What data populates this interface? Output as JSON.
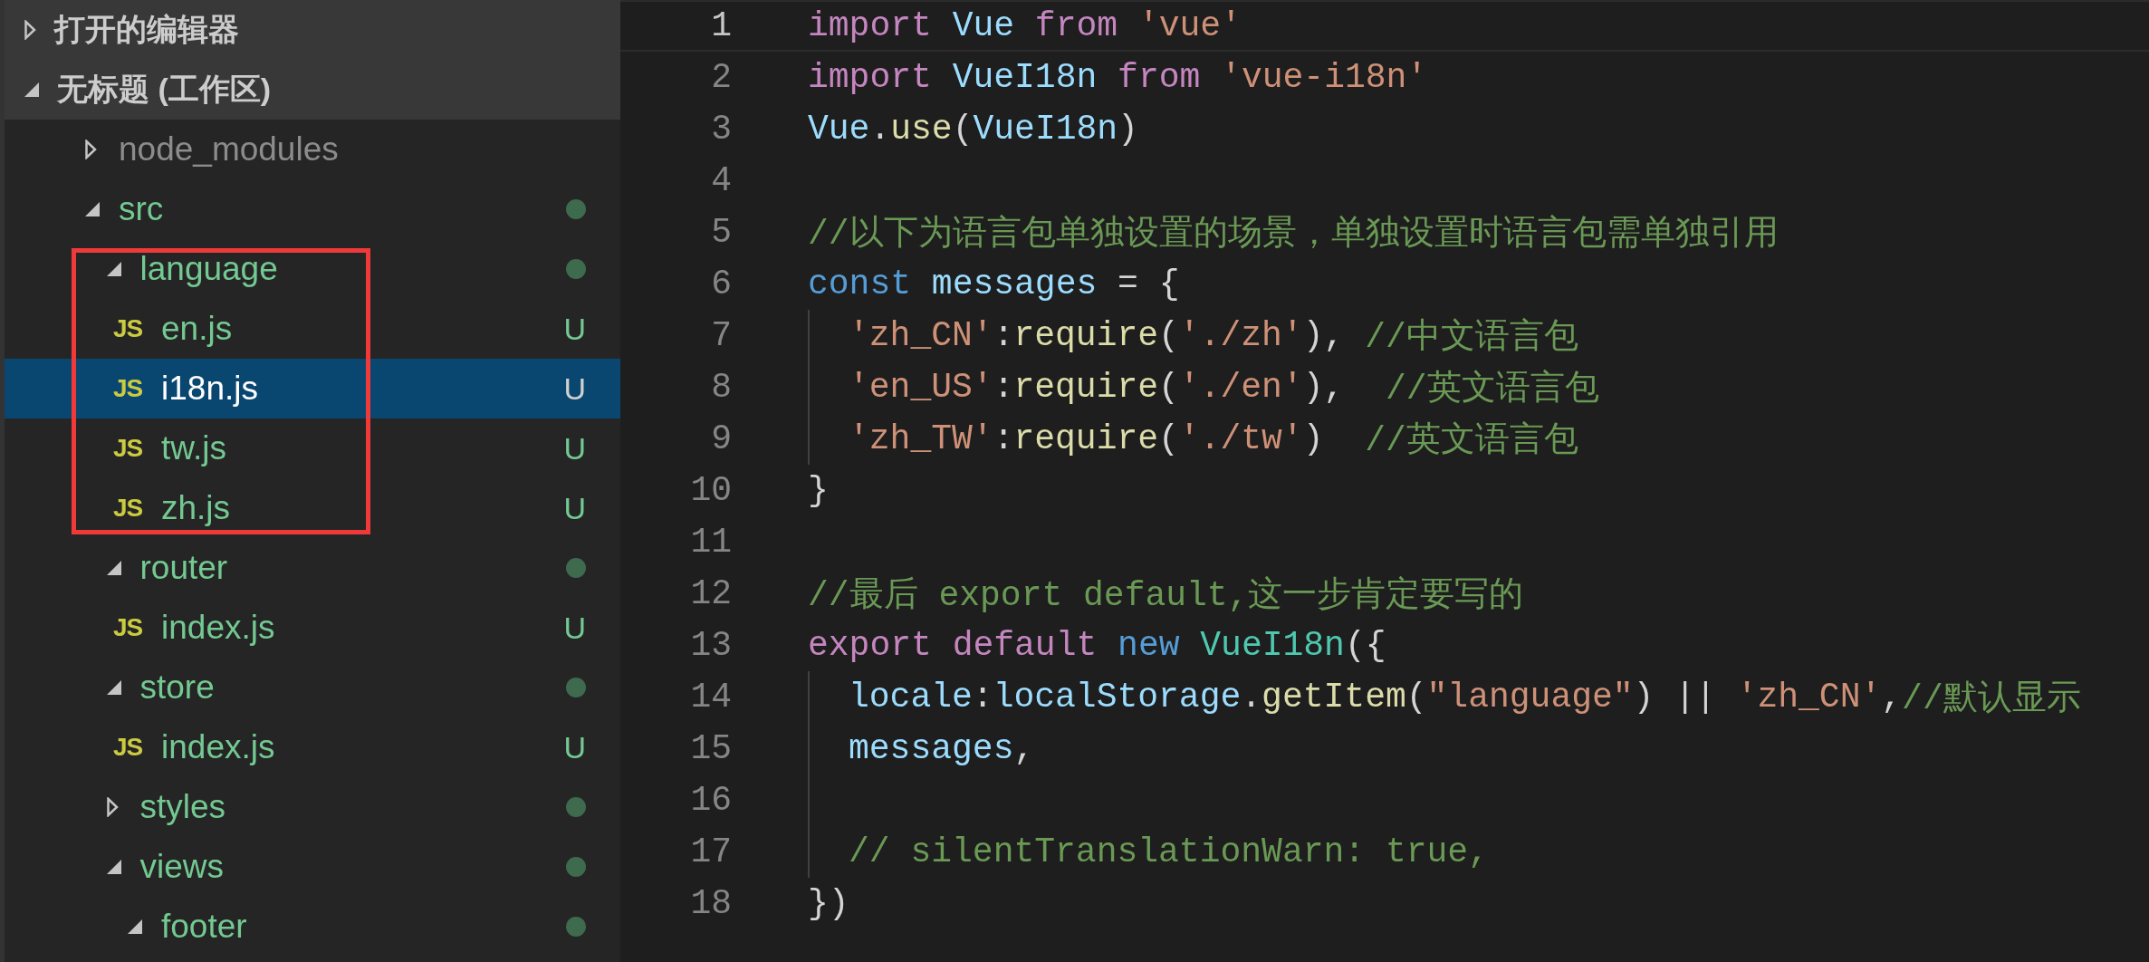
{
  "explorer": {
    "sections": [
      {
        "title": "打开的编辑器",
        "expanded": false
      },
      {
        "title": "无标题 (工作区)",
        "expanded": true,
        "tree": [
          {
            "kind": "folder",
            "name": "node_modules",
            "expanded": false,
            "ignored": true,
            "modified": false,
            "selected": false,
            "framed": false
          },
          {
            "kind": "folder",
            "name": "src",
            "expanded": true,
            "ignored": false,
            "modified": true,
            "selected": false,
            "framed": false,
            "children": [
              {
                "kind": "folder",
                "name": "language",
                "expanded": true,
                "ignored": false,
                "modified": true,
                "selected": false,
                "framed": true,
                "children": [
                  {
                    "kind": "file",
                    "icon": "JS",
                    "name": "en.js",
                    "badge": "U",
                    "ignored": false,
                    "selected": false
                  },
                  {
                    "kind": "file",
                    "icon": "JS",
                    "name": "i18n.js",
                    "badge": "U",
                    "ignored": false,
                    "selected": true
                  },
                  {
                    "kind": "file",
                    "icon": "JS",
                    "name": "tw.js",
                    "badge": "U",
                    "ignored": false,
                    "selected": false
                  },
                  {
                    "kind": "file",
                    "icon": "JS",
                    "name": "zh.js",
                    "badge": "U",
                    "ignored": false,
                    "selected": false
                  }
                ]
              },
              {
                "kind": "folder",
                "name": "router",
                "expanded": true,
                "ignored": false,
                "modified": true,
                "selected": false,
                "framed": false,
                "children": [
                  {
                    "kind": "file",
                    "icon": "JS",
                    "name": "index.js",
                    "badge": "U",
                    "ignored": false,
                    "selected": false
                  }
                ]
              },
              {
                "kind": "folder",
                "name": "store",
                "expanded": true,
                "ignored": false,
                "modified": true,
                "selected": false,
                "framed": false,
                "children": [
                  {
                    "kind": "file",
                    "icon": "JS",
                    "name": "index.js",
                    "badge": "U",
                    "ignored": false,
                    "selected": false
                  }
                ]
              },
              {
                "kind": "folder",
                "name": "styles",
                "expanded": false,
                "ignored": false,
                "modified": true,
                "selected": false,
                "framed": false
              },
              {
                "kind": "folder",
                "name": "views",
                "expanded": true,
                "ignored": false,
                "modified": true,
                "selected": false,
                "framed": false,
                "children": [
                  {
                    "kind": "folder",
                    "name": "footer",
                    "expanded": true,
                    "ignored": false,
                    "modified": true,
                    "selected": false,
                    "framed": false
                  }
                ]
              }
            ]
          }
        ]
      }
    ]
  },
  "editor": {
    "lines": [
      {
        "number": "1",
        "current": true,
        "indented": false,
        "tokens": [
          {
            "kind": "kw",
            "text": "import "
          },
          {
            "kind": "var",
            "text": "Vue "
          },
          {
            "kind": "kw",
            "text": "from "
          },
          {
            "kind": "str",
            "text": "'vue'"
          }
        ]
      },
      {
        "number": "2",
        "current": false,
        "indented": false,
        "tokens": [
          {
            "kind": "kw",
            "text": "import "
          },
          {
            "kind": "var",
            "text": "VueI18n "
          },
          {
            "kind": "kw",
            "text": "from "
          },
          {
            "kind": "str",
            "text": "'vue-i18n'"
          }
        ]
      },
      {
        "number": "3",
        "current": false,
        "indented": false,
        "tokens": [
          {
            "kind": "var",
            "text": "Vue"
          },
          {
            "kind": "p",
            "text": "."
          },
          {
            "kind": "fn",
            "text": "use"
          },
          {
            "kind": "p",
            "text": "("
          },
          {
            "kind": "var",
            "text": "VueI18n"
          },
          {
            "kind": "p",
            "text": ")"
          }
        ]
      },
      {
        "number": "4",
        "current": false,
        "indented": false
      },
      {
        "number": "5",
        "current": false,
        "indented": false,
        "tokens": [
          {
            "kind": "cm",
            "text": "//以下为语言包单独设置的场景，单独设置时语言包需单独引用"
          }
        ]
      },
      {
        "number": "6",
        "current": false,
        "indented": false,
        "tokens": [
          {
            "kind": "dec",
            "text": "const "
          },
          {
            "kind": "var",
            "text": "messages "
          },
          {
            "kind": "p",
            "text": "= {"
          }
        ]
      },
      {
        "number": "7",
        "current": false,
        "indented": true,
        "tokens": [
          {
            "kind": "str",
            "text": "'zh_CN'"
          },
          {
            "kind": "p",
            "text": ":"
          },
          {
            "kind": "fn",
            "text": "require"
          },
          {
            "kind": "p",
            "text": "("
          },
          {
            "kind": "str",
            "text": "'./zh'"
          },
          {
            "kind": "p",
            "text": "), "
          },
          {
            "kind": "cm",
            "text": "//中文语言包"
          }
        ]
      },
      {
        "number": "8",
        "current": false,
        "indented": true,
        "tokens": [
          {
            "kind": "str",
            "text": "'en_US'"
          },
          {
            "kind": "p",
            "text": ":"
          },
          {
            "kind": "fn",
            "text": "require"
          },
          {
            "kind": "p",
            "text": "("
          },
          {
            "kind": "str",
            "text": "'./en'"
          },
          {
            "kind": "p",
            "text": "),  "
          },
          {
            "kind": "cm",
            "text": "//英文语言包"
          }
        ]
      },
      {
        "number": "9",
        "current": false,
        "indented": true,
        "tokens": [
          {
            "kind": "str",
            "text": "'zh_TW'"
          },
          {
            "kind": "p",
            "text": ":"
          },
          {
            "kind": "fn",
            "text": "require"
          },
          {
            "kind": "p",
            "text": "("
          },
          {
            "kind": "str",
            "text": "'./tw'"
          },
          {
            "kind": "p",
            "text": ")  "
          },
          {
            "kind": "cm",
            "text": "//英文语言包"
          }
        ]
      },
      {
        "number": "10",
        "current": false,
        "indented": false,
        "tokens": [
          {
            "kind": "p",
            "text": "}"
          }
        ]
      },
      {
        "number": "11",
        "current": false,
        "indented": false
      },
      {
        "number": "12",
        "current": false,
        "indented": false,
        "tokens": [
          {
            "kind": "cm",
            "text": "//最后 export default,这一步肯定要写的"
          }
        ]
      },
      {
        "number": "13",
        "current": false,
        "indented": false,
        "tokens": [
          {
            "kind": "kw",
            "text": "export "
          },
          {
            "kind": "kw",
            "text": "default "
          },
          {
            "kind": "dec",
            "text": "new "
          },
          {
            "kind": "cls",
            "text": "VueI18n"
          },
          {
            "kind": "p",
            "text": "({"
          }
        ]
      },
      {
        "number": "14",
        "current": false,
        "indented": true,
        "tokens": [
          {
            "kind": "var",
            "text": "locale"
          },
          {
            "kind": "p",
            "text": ":"
          },
          {
            "kind": "var",
            "text": "localStorage"
          },
          {
            "kind": "p",
            "text": "."
          },
          {
            "kind": "fn",
            "text": "getItem"
          },
          {
            "kind": "p",
            "text": "("
          },
          {
            "kind": "str",
            "text": "\"language\""
          },
          {
            "kind": "p",
            "text": ") || "
          },
          {
            "kind": "str",
            "text": "'zh_CN'"
          },
          {
            "kind": "p",
            "text": ","
          },
          {
            "kind": "cm",
            "text": "//默认显示"
          }
        ]
      },
      {
        "number": "15",
        "current": false,
        "indented": true,
        "tokens": [
          {
            "kind": "var",
            "text": "messages"
          },
          {
            "kind": "p",
            "text": ","
          }
        ]
      },
      {
        "number": "16",
        "current": false,
        "indented": true
      },
      {
        "number": "17",
        "current": false,
        "indented": true,
        "tokens": [
          {
            "kind": "cm",
            "text": "// silentTranslationWarn: true,"
          }
        ]
      },
      {
        "number": "18",
        "current": false,
        "indented": false,
        "tokens": [
          {
            "kind": "p",
            "text": "})"
          }
        ]
      }
    ]
  }
}
